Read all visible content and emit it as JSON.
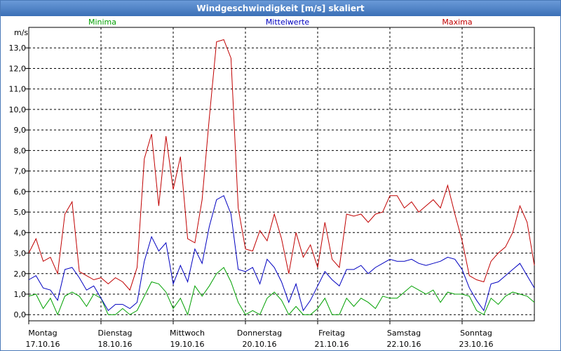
{
  "window": {
    "title": "Windgeschwindigkeit [m/s] skaliert"
  },
  "chart_data": {
    "type": "line",
    "title": "Windgeschwindigkeit [m/s] skaliert",
    "ylabel": "m/s",
    "ylim": [
      -0.3,
      14.0
    ],
    "yticks": [
      "0,0",
      "1,0",
      "2,0",
      "3,0",
      "4,0",
      "5,0",
      "6,0",
      "7,0",
      "8,0",
      "9,0",
      "10,0",
      "11,0",
      "12,0",
      "13,0"
    ],
    "ytick_values": [
      0,
      1,
      2,
      3,
      4,
      5,
      6,
      7,
      8,
      9,
      10,
      11,
      12,
      13
    ],
    "xlim": [
      0,
      7
    ],
    "xticks": [
      {
        "day": "Montag",
        "date": "17.10.16"
      },
      {
        "day": "Dienstag",
        "date": "18.10.16"
      },
      {
        "day": "Mittwoch",
        "date": "19.10.16"
      },
      {
        "day": "Donnerstag",
        "date": "20.10.16"
      },
      {
        "day": "Freitag",
        "date": "21.10.16"
      },
      {
        "day": "Samstag",
        "date": "22.10.16"
      },
      {
        "day": "Sonntag",
        "date": "23.10.16"
      }
    ],
    "grid": true,
    "legend_position": "top",
    "series": [
      {
        "name": "Minima",
        "color": "#00a000",
        "x": [
          0,
          0.1,
          0.2,
          0.3,
          0.4,
          0.5,
          0.6,
          0.7,
          0.8,
          0.9,
          1.0,
          1.1,
          1.2,
          1.3,
          1.4,
          1.5,
          1.6,
          1.7,
          1.8,
          1.9,
          2.0,
          2.1,
          2.2,
          2.3,
          2.4,
          2.5,
          2.6,
          2.7,
          2.8,
          2.9,
          3.0,
          3.1,
          3.2,
          3.3,
          3.4,
          3.5,
          3.6,
          3.7,
          3.8,
          3.9,
          4.0,
          4.1,
          4.2,
          4.3,
          4.4,
          4.5,
          4.6,
          4.7,
          4.8,
          4.9,
          5.0,
          5.1,
          5.2,
          5.3,
          5.4,
          5.5,
          5.6,
          5.7,
          5.8,
          5.9,
          6.0,
          6.1,
          6.2,
          6.3,
          6.4,
          6.5,
          6.6,
          6.7,
          6.8,
          6.9,
          7.0
        ],
        "y": [
          0.9,
          1.0,
          0.3,
          0.8,
          0.0,
          0.9,
          1.1,
          0.9,
          0.4,
          1.0,
          0.8,
          0.0,
          0.0,
          0.3,
          0.0,
          0.2,
          0.9,
          1.6,
          1.5,
          1.1,
          0.3,
          0.8,
          0.0,
          1.4,
          0.9,
          1.4,
          2.0,
          2.3,
          1.6,
          0.6,
          0.0,
          0.2,
          0.0,
          0.8,
          1.1,
          0.7,
          0.0,
          0.4,
          0.0,
          0.0,
          0.3,
          0.8,
          0.0,
          0.0,
          0.8,
          0.4,
          0.8,
          0.6,
          0.3,
          0.9,
          0.8,
          0.8,
          1.1,
          1.4,
          1.2,
          1.0,
          1.2,
          0.6,
          1.1,
          1.0,
          1.0,
          0.9,
          0.2,
          0.0,
          0.8,
          0.5,
          0.9,
          1.1,
          1.0,
          0.9,
          0.6
        ]
      },
      {
        "name": "Mittelwerte",
        "color": "#0000c0",
        "x": [
          0,
          0.1,
          0.2,
          0.3,
          0.4,
          0.5,
          0.6,
          0.7,
          0.8,
          0.9,
          1.0,
          1.1,
          1.2,
          1.3,
          1.4,
          1.5,
          1.6,
          1.7,
          1.8,
          1.9,
          2.0,
          2.1,
          2.2,
          2.3,
          2.4,
          2.5,
          2.6,
          2.7,
          2.8,
          2.9,
          3.0,
          3.1,
          3.2,
          3.3,
          3.4,
          3.5,
          3.6,
          3.7,
          3.8,
          3.9,
          4.0,
          4.1,
          4.2,
          4.3,
          4.4,
          4.5,
          4.6,
          4.7,
          4.8,
          4.9,
          5.0,
          5.1,
          5.2,
          5.3,
          5.4,
          5.5,
          5.6,
          5.7,
          5.8,
          5.9,
          6.0,
          6.1,
          6.2,
          6.3,
          6.4,
          6.5,
          6.6,
          6.7,
          6.8,
          6.9,
          7.0
        ],
        "y": [
          1.7,
          1.9,
          1.3,
          1.2,
          0.7,
          2.2,
          2.3,
          1.8,
          1.2,
          1.4,
          0.8,
          0.2,
          0.5,
          0.5,
          0.3,
          0.6,
          2.6,
          3.8,
          3.1,
          3.5,
          1.5,
          2.4,
          1.6,
          3.2,
          2.5,
          4.3,
          5.6,
          5.8,
          4.9,
          2.2,
          2.1,
          2.3,
          1.5,
          2.7,
          2.3,
          1.6,
          0.6,
          1.5,
          0.2,
          0.7,
          1.4,
          2.1,
          1.7,
          1.4,
          2.2,
          2.2,
          2.4,
          2.0,
          2.3,
          2.5,
          2.7,
          2.6,
          2.6,
          2.7,
          2.5,
          2.4,
          2.5,
          2.6,
          2.8,
          2.7,
          2.2,
          1.3,
          0.7,
          0.2,
          1.5,
          1.6,
          1.9,
          2.2,
          2.5,
          1.9,
          1.3
        ]
      },
      {
        "name": "Maxima",
        "color": "#c00000",
        "x": [
          0,
          0.1,
          0.2,
          0.3,
          0.4,
          0.5,
          0.6,
          0.7,
          0.8,
          0.9,
          1.0,
          1.1,
          1.2,
          1.3,
          1.4,
          1.5,
          1.6,
          1.7,
          1.8,
          1.9,
          2.0,
          2.1,
          2.2,
          2.3,
          2.4,
          2.5,
          2.6,
          2.7,
          2.8,
          2.9,
          3.0,
          3.1,
          3.2,
          3.3,
          3.4,
          3.5,
          3.6,
          3.7,
          3.8,
          3.9,
          4.0,
          4.1,
          4.2,
          4.3,
          4.4,
          4.5,
          4.6,
          4.7,
          4.8,
          4.9,
          5.0,
          5.1,
          5.2,
          5.3,
          5.4,
          5.5,
          5.6,
          5.7,
          5.8,
          5.9,
          6.0,
          6.1,
          6.2,
          6.3,
          6.4,
          6.5,
          6.6,
          6.7,
          6.8,
          6.9,
          7.0
        ],
        "y": [
          3.0,
          3.7,
          2.6,
          2.8,
          2.0,
          4.9,
          5.5,
          2.1,
          1.9,
          1.7,
          1.8,
          1.5,
          1.8,
          1.6,
          1.2,
          2.3,
          7.6,
          8.8,
          5.3,
          8.7,
          6.1,
          7.7,
          3.7,
          3.5,
          5.6,
          9.6,
          13.3,
          13.4,
          12.5,
          5.2,
          3.2,
          3.1,
          4.1,
          3.6,
          4.9,
          3.7,
          2.0,
          4.0,
          2.8,
          3.4,
          2.3,
          4.5,
          2.7,
          2.3,
          4.9,
          4.8,
          4.9,
          4.5,
          4.9,
          5.0,
          5.8,
          5.8,
          5.2,
          5.5,
          5.0,
          5.3,
          5.6,
          5.2,
          6.3,
          4.9,
          3.6,
          1.9,
          1.7,
          1.6,
          2.6,
          3.0,
          3.3,
          4.0,
          5.3,
          4.5,
          2.4
        ]
      }
    ]
  }
}
